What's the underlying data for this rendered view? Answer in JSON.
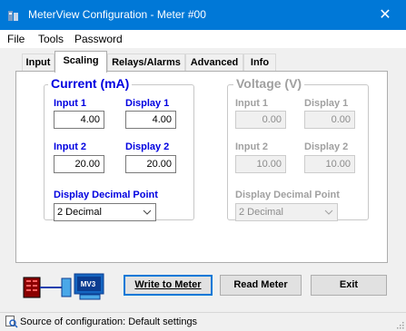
{
  "window": {
    "title": "MeterView Configuration - Meter #00",
    "close_glyph": "✕"
  },
  "menu": [
    "File",
    "Tools",
    "Password"
  ],
  "tabs": [
    {
      "label": "Input",
      "active": false
    },
    {
      "label": "Scaling",
      "active": true
    },
    {
      "label": "Relays/Alarms",
      "active": false
    },
    {
      "label": "Advanced",
      "active": false
    },
    {
      "label": "Info",
      "active": false
    }
  ],
  "current": {
    "title": "Current (mA)",
    "input1_label": "Input 1",
    "input1_value": "4.00",
    "display1_label": "Display 1",
    "display1_value": "4.00",
    "input2_label": "Input 2",
    "input2_value": "20.00",
    "display2_label": "Display 2",
    "display2_value": "20.00",
    "decimal_label": "Display Decimal Point",
    "decimal_value": "2 Decimal"
  },
  "voltage": {
    "title": "Voltage (V)",
    "input1_label": "Input 1",
    "input1_value": "0.00",
    "display1_label": "Display 1",
    "display1_value": "0.00",
    "input2_label": "Input 2",
    "input2_value": "10.00",
    "display2_label": "Display 2",
    "display2_value": "10.00",
    "decimal_label": "Display Decimal Point",
    "decimal_value": "2 Decimal",
    "enabled": false
  },
  "buttons": {
    "write": "Write to Meter",
    "read": "Read Meter",
    "exit": "Exit"
  },
  "connection": {
    "meter_icon": "meter-icon",
    "pc_icon": "computer-icon",
    "pc_badge": "MV3"
  },
  "status": {
    "text": "Source of configuration: Default settings",
    "icon": "search-icon"
  },
  "colors": {
    "titlebar": "#0078d7",
    "group_title": "#0000e0",
    "disabled_text": "#a0a0a0",
    "default_button_border": "#0078d7"
  }
}
